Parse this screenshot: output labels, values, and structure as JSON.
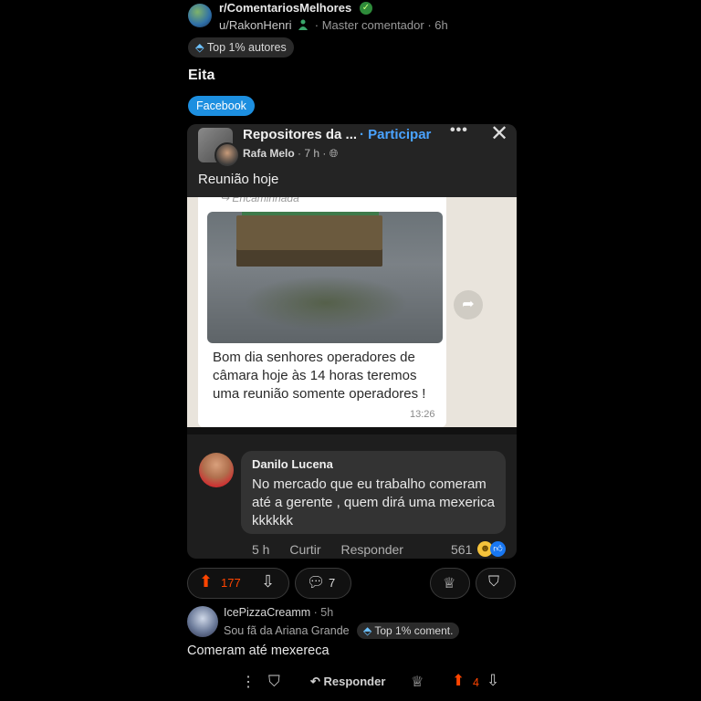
{
  "post": {
    "subreddit": "r/ComentariosMelhores",
    "username": "u/RakonHenri",
    "user_flair": "Master comentador",
    "age": "6h",
    "top_badge": "Top 1% autores",
    "title": "Eita",
    "flair": "Facebook",
    "accent_color": "#ff4500",
    "flair_color": "#1d8fe0"
  },
  "facebook_card": {
    "group_name": "Repositores da ...",
    "join_label": "Participar",
    "poster": "Rafa Melo",
    "poster_meta": "· 7 h ·",
    "post_text": "Reunião hoje",
    "forwarded_label": "Encaminhada",
    "message": "Bom dia senhores operadores de câmara hoje às 14 horas teremos uma reunião somente operadores !",
    "message_time": "13:26",
    "comment": {
      "author": "Danilo Lucena",
      "text": "No mercado que eu trabalho comeram até a gerente , quem dirá uma mexerica  kkkkkk",
      "age": "5 h",
      "action_curtir": "Curtir",
      "action_responder": "Responder",
      "reaction_count": "561"
    }
  },
  "actions": {
    "score": "177",
    "comments": "7"
  },
  "reply": {
    "username": "IcePizzaCreamm",
    "age": "5h",
    "flair": "Sou fã da Ariana Grande",
    "badge": "Top 1% coment.",
    "text": "Comeram até mexereca",
    "reply_label": "Responder",
    "score": "4"
  }
}
